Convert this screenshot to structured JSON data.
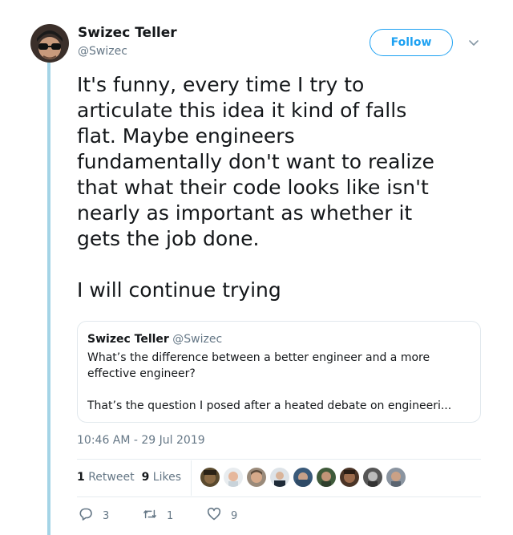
{
  "author": {
    "name": "Swizec Teller",
    "handle": "@Swizec"
  },
  "follow_label": "Follow",
  "tweet_text": "It's funny, every time I try to\narticulate this idea it kind of falls\nflat. Maybe engineers\nfundamentally don't want to realize\nthat what their code looks like isn't\nnearly as important as whether it\ngets the job done.\n\nI will continue trying",
  "quoted": {
    "name": "Swizec Teller",
    "handle": "@Swizec",
    "text": "What’s the difference between a better engineer and a more\neffective engineer?\n\nThat’s the question I posed after a heated debate on engineeri..."
  },
  "timestamp": "10:46 AM - 29 Jul 2019",
  "stats": {
    "retweets_count": "1",
    "retweets_label": "Retweet",
    "likes_count": "9",
    "likes_label": "Likes"
  },
  "actions": {
    "replies": "3",
    "retweets": "1",
    "likes": "9"
  },
  "icons": [
    "chevron-down-icon",
    "reply-icon",
    "retweet-icon",
    "heart-icon"
  ],
  "colors": {
    "accent": "#1da1f2",
    "thread_line": "#a4d4e6",
    "secondary_text": "#657786",
    "border": "#e1e8ed"
  }
}
